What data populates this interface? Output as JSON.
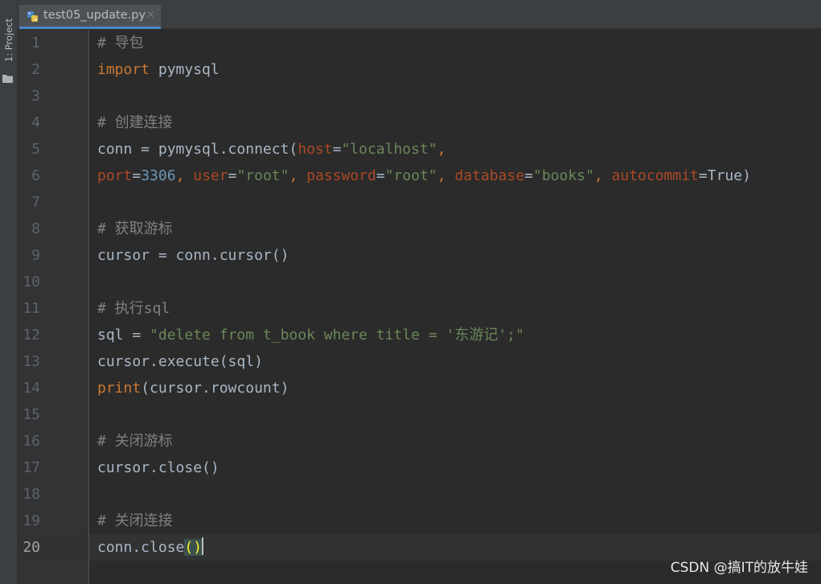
{
  "sidebar": {
    "project_label": "1: Project",
    "folder_icon": "folder-icon"
  },
  "tab": {
    "title": "test05_update.py",
    "icon": "python-file-icon",
    "close": "×"
  },
  "editor": {
    "line_numbers": [
      "1",
      "2",
      "3",
      "4",
      "5",
      "6",
      "7",
      "8",
      "9",
      "10",
      "11",
      "12",
      "13",
      "14",
      "15",
      "16",
      "17",
      "18",
      "19",
      "20"
    ],
    "current_line": 20,
    "lines": {
      "l1": {
        "comment": "# 导包"
      },
      "l2": {
        "kw": "import",
        "rest": " pymysql"
      },
      "l4": {
        "comment": "# 创建连接"
      },
      "l5": {
        "a": "conn = pymysql.connect(",
        "p_host": "host",
        "eq1": "=",
        "s_host": "\"localhost\"",
        "comma": ","
      },
      "l6": {
        "p_port": "port",
        "eq1": "=",
        "n_port": "3306",
        "c1": ", ",
        "p_user": "user",
        "eq2": "=",
        "s_user": "\"root\"",
        "c2": ", ",
        "p_password": "password",
        "eq3": "=",
        "s_password": "\"root\"",
        "c3": ", ",
        "p_database": "database",
        "eq4": "=",
        "s_database": "\"books\"",
        "c4": ", ",
        "p_autocommit": "autocommit",
        "eq5": "=",
        "v_true": "True",
        "close": ")"
      },
      "l8": {
        "comment": "# 获取游标"
      },
      "l9": {
        "text": "cursor = conn.cursor()"
      },
      "l11": {
        "comment": "# 执行sql"
      },
      "l12": {
        "a": "sql = ",
        "s_sql": "\"delete from t_book where title = '东游记';\""
      },
      "l13": {
        "text": "cursor.execute(sql)"
      },
      "l14": {
        "builtin": "print",
        "rest": "(cursor.rowcount)"
      },
      "l16": {
        "comment": "# 关闭游标"
      },
      "l17": {
        "text": "cursor.close()"
      },
      "l19": {
        "comment": "# 关闭连接"
      },
      "l20": {
        "a": "conn.close",
        "paren": "()"
      }
    }
  },
  "watermark": "CSDN @搞IT的放牛娃",
  "colors": {
    "background": "#2b2b2b",
    "comment": "#808080",
    "keyword": "#cc7832",
    "string": "#6a8759",
    "number": "#6897bb",
    "param": "#aa4926",
    "default": "#a9b7c6"
  }
}
